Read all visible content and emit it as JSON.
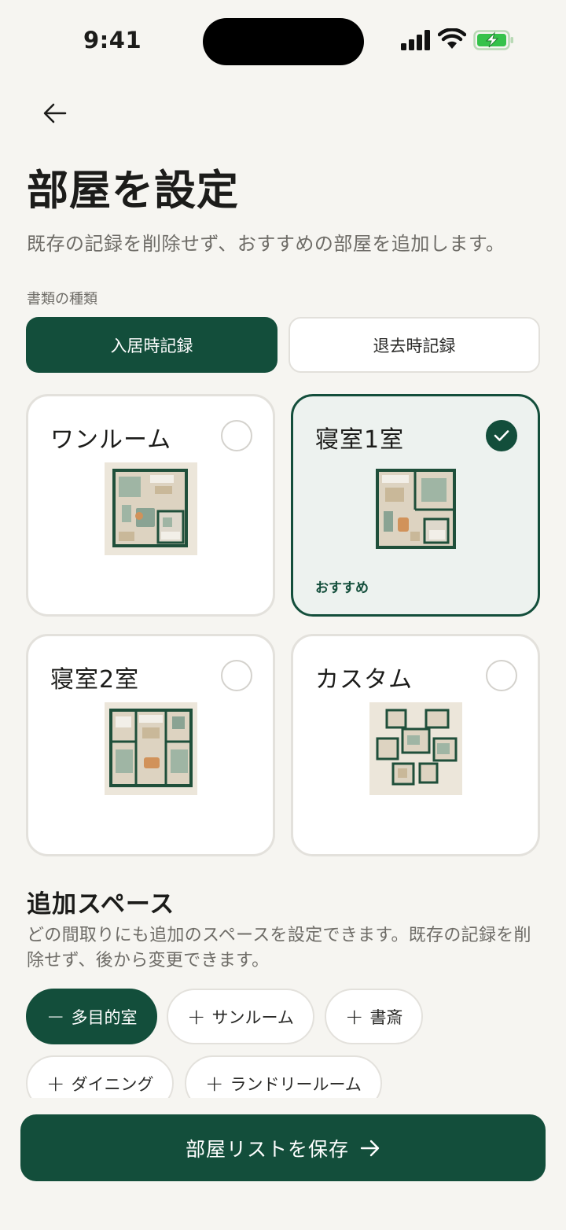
{
  "status": {
    "time": "9:41"
  },
  "header": {
    "title": "部屋を設定",
    "subtitle": "既存の記録を削除せず、おすすめの部屋を追加します。"
  },
  "document_type": {
    "label": "書類の種類",
    "options": [
      "入居時記録",
      "退去時記録"
    ],
    "selected": "入居時記録"
  },
  "layouts": [
    {
      "title": "ワンルーム",
      "selected": false,
      "badge": ""
    },
    {
      "title": "寝室1室",
      "selected": true,
      "badge": "おすすめ"
    },
    {
      "title": "寝室2室",
      "selected": false,
      "badge": ""
    },
    {
      "title": "カスタム",
      "selected": false,
      "badge": ""
    }
  ],
  "extra_spaces": {
    "title": "追加スペース",
    "description": "どの間取りにも追加のスペースを設定できます。既存の記録を削除せず、後から変更できます。",
    "chips": [
      {
        "label": "多目的室",
        "symbol": "−",
        "active": true
      },
      {
        "label": "サンルーム",
        "symbol": "+",
        "active": false
      },
      {
        "label": "書斎",
        "symbol": "+",
        "active": false
      },
      {
        "label": "ダイニング",
        "symbol": "+",
        "active": false
      },
      {
        "label": "ランドリールーム",
        "symbol": "+",
        "active": false
      }
    ]
  },
  "footer": {
    "save_label": "部屋リストを保存"
  },
  "colors": {
    "accent": "#134e3b",
    "background": "#f6f5f1",
    "selected_card": "#edf2ef"
  }
}
